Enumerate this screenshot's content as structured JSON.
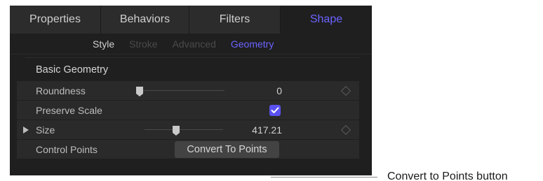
{
  "tabs": [
    {
      "label": "Properties"
    },
    {
      "label": "Behaviors"
    },
    {
      "label": "Filters"
    },
    {
      "label": "Shape",
      "active": true
    }
  ],
  "subtabs": [
    {
      "label": "Style"
    },
    {
      "label": "Stroke"
    },
    {
      "label": "Advanced"
    },
    {
      "label": "Geometry",
      "active": true
    }
  ],
  "section_title": "Basic Geometry",
  "rows": {
    "roundness": {
      "label": "Roundness",
      "value": "0",
      "slider_fraction": 0
    },
    "preserve_scale": {
      "label": "Preserve Scale",
      "checked": true
    },
    "size": {
      "label": "Size",
      "value": "417.21",
      "slider_fraction": 0.4
    },
    "control_points": {
      "label": "Control Points",
      "button_label": "Convert To Points"
    }
  },
  "callout": {
    "text": "Convert to Points button"
  },
  "colors": {
    "accent": "#6b63ff",
    "checkbox": "#5a52f0",
    "panel_bg": "#1f1f1f",
    "row_bg": "#2a2a2a"
  }
}
